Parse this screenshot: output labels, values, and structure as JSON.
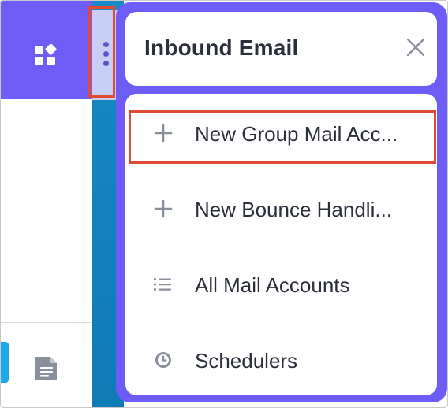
{
  "panel": {
    "title": "Inbound Email",
    "close_icon": "close-icon"
  },
  "menu": {
    "items": [
      {
        "label": "New Group Mail Acc...",
        "icon": "plus-icon"
      },
      {
        "label": "New Bounce Handli...",
        "icon": "plus-icon"
      },
      {
        "label": "All Mail Accounts",
        "icon": "list-icon"
      },
      {
        "label": "Schedulers",
        "icon": "clock-icon"
      }
    ]
  },
  "app": {
    "header_icon": "apps-grid-icon",
    "sidebar_icon": "document-icon",
    "kebab_icon": "kebab-menu-icon"
  },
  "colors": {
    "accent": "#6d5cf6",
    "highlight": "#e24b33",
    "strip": "#1789c4",
    "text": "#2b2f3a",
    "icon_gray": "#8a8f9c"
  }
}
